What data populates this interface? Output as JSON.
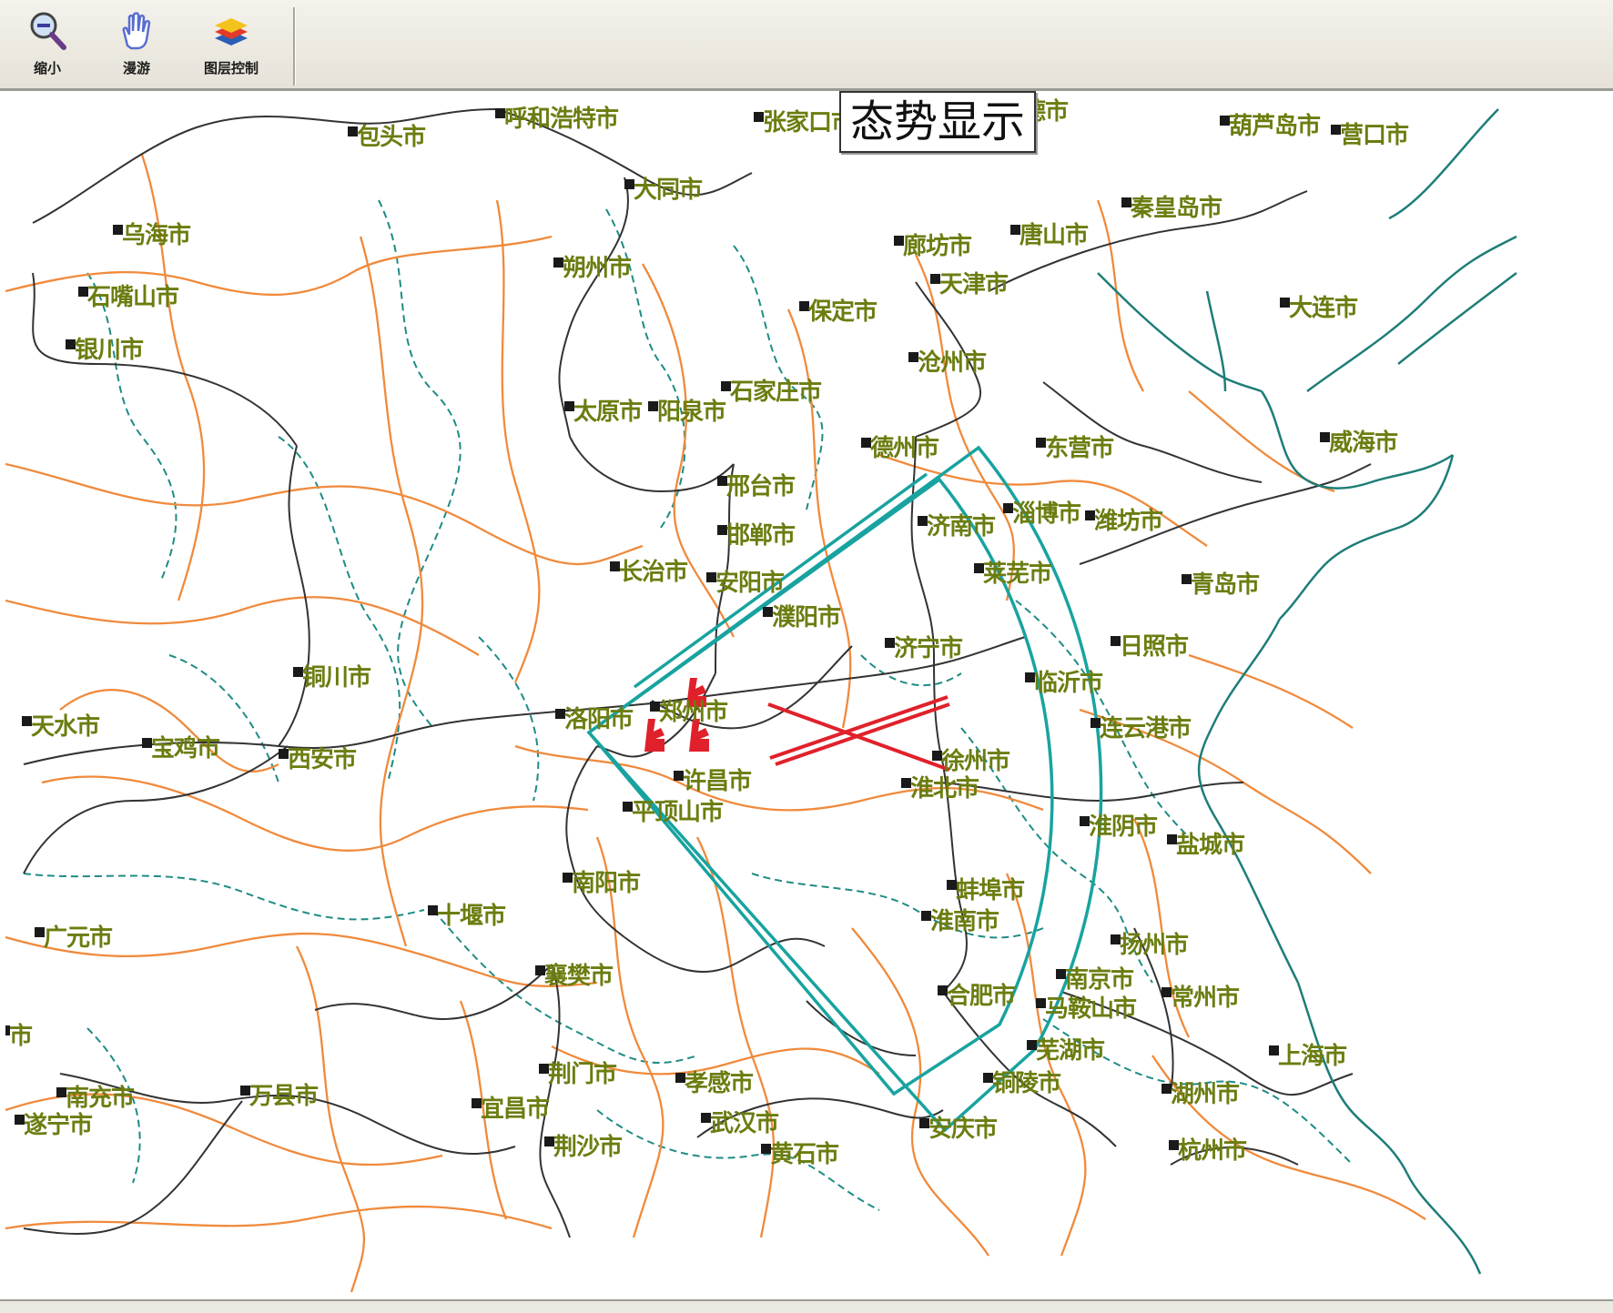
{
  "toolbar": {
    "tools": [
      {
        "label": "缩小",
        "icon": "zoom-out-icon"
      },
      {
        "label": "漫游",
        "icon": "hand-pan-icon"
      },
      {
        "label": "图层控制",
        "icon": "layers-icon"
      }
    ]
  },
  "map": {
    "title": "态势显示",
    "colors": {
      "road": "#f08a3c",
      "rail": "#333333",
      "boundary": "#1e8c84",
      "sector": "#18a3a0",
      "target": "#e0212b",
      "label": "#6b7d10"
    },
    "cities": [
      "包头市",
      "呼和浩特市",
      "张家口市",
      "承德市",
      "葫芦岛市",
      "营口市",
      "大同市",
      "秦皇岛市",
      "乌海市",
      "廊坊市",
      "唐山市",
      "朔州市",
      "石嘴山市",
      "天津市",
      "保定市",
      "大连市",
      "银川市",
      "沧州市",
      "太原市",
      "阳泉市",
      "石家庄市",
      "德州市",
      "东营市",
      "威海市",
      "邢台市",
      "淄博市",
      "潍坊市",
      "济南市",
      "邯郸市",
      "长治市",
      "安阳市",
      "莱芜市",
      "青岛市",
      "濮阳市",
      "济宁市",
      "日照市",
      "铜川市",
      "临沂市",
      "天水市",
      "宝鸡市",
      "西安市",
      "洛阳市",
      "郑州市",
      "连云港市",
      "徐州市",
      "许昌市",
      "淮北市",
      "平顶山市",
      "淮阴市",
      "盐城市",
      "南阳市",
      "蚌埠市",
      "十堰市",
      "淮南市",
      "扬州市",
      "广元市",
      "襄樊市",
      "南京市",
      "合肥市",
      "马鞍山市",
      "常州市",
      "芜湖市",
      "上海市",
      "荆门市",
      "孝感市",
      "铜陵市",
      "湖州市",
      "南充市",
      "万县市",
      "宜昌市",
      "遂宁市",
      "武汉市",
      "安庆市",
      "杭州市",
      "荆沙市",
      "黄石市",
      "市"
    ]
  }
}
